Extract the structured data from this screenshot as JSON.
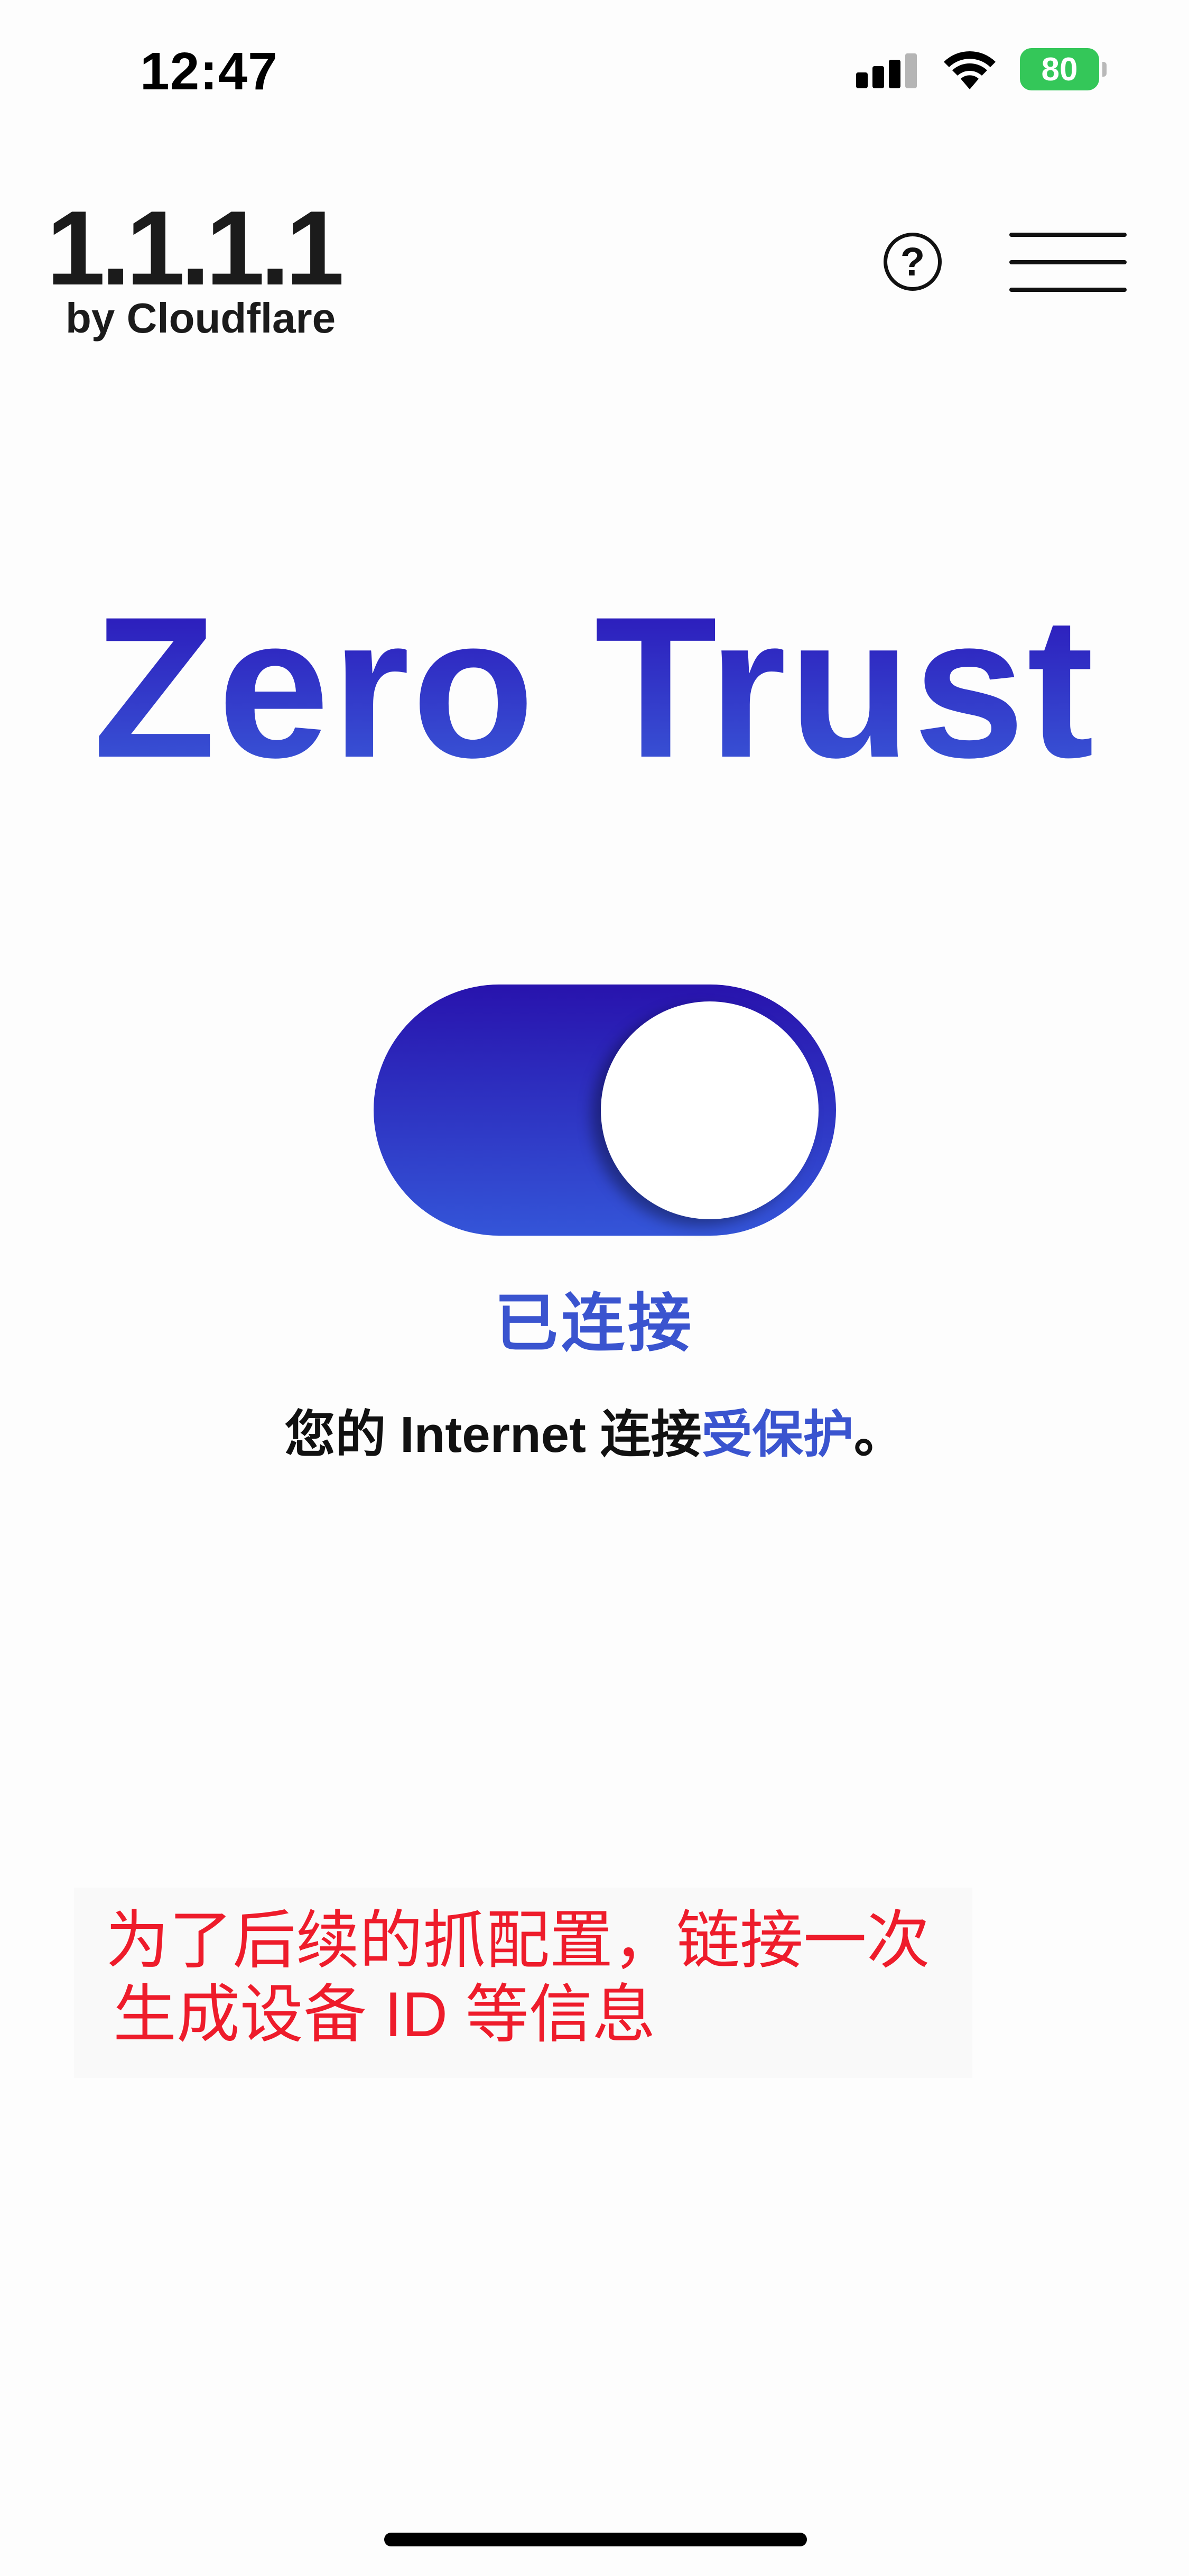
{
  "status_bar": {
    "time": "12:47",
    "battery": "80"
  },
  "header": {
    "logo_main": "1.1.1.1",
    "logo_sub": "by Cloudflare",
    "help_icon_glyph": "?"
  },
  "main": {
    "title": "Zero Trust",
    "toggle_state": "on",
    "status_label": "已连接",
    "status_message_prefix": "您的 Internet 连接",
    "status_message_highlight": "受保护",
    "status_message_suffix": "。"
  },
  "annotation": {
    "line1": "为了后续的抓配置，链接一次",
    "line2": "生成设备 ID 等信息"
  },
  "colors": {
    "accent": "#3a54cf",
    "gradient_top": "#2813ad",
    "gradient_bottom": "#3455d8",
    "battery": "#34c759",
    "annotation": "#ee1c2b"
  },
  "icons": [
    "cellular-signal-icon",
    "wifi-icon",
    "battery-icon",
    "help-icon",
    "hamburger-menu-icon"
  ]
}
